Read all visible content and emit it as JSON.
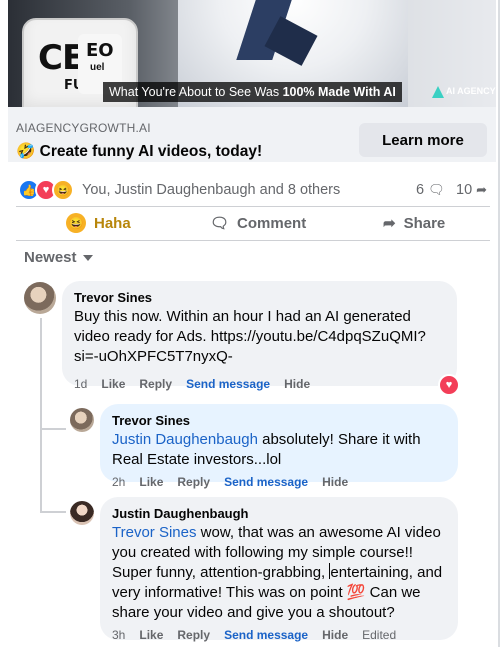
{
  "ad": {
    "caption_prefix": "What You're About to See Was ",
    "caption_bold": "100% Made With AI",
    "can_label_1": "CEO",
    "can_label_2": "FUEL",
    "can2_label_1": "EO",
    "can2_label_2": "uel",
    "brand_label": "AI AGENCY",
    "domain": "AIAGENCYGROWTH.AI",
    "headline_emoji": "🤣",
    "headline": "Create funny AI videos, today!",
    "cta": "Learn more"
  },
  "reactions": {
    "summary": "You, Justin Daughenbaugh and 8 others",
    "comment_count": "6",
    "share_count": "10",
    "icons": [
      "like-icon",
      "love-icon",
      "haha-icon"
    ]
  },
  "actions": {
    "haha": "Haha",
    "comment": "Comment",
    "share": "Share"
  },
  "sort": {
    "label": "Newest"
  },
  "comments": [
    {
      "author": "Trevor Sines",
      "text": "Buy this now. Within an hour I had an AI generated video ready for Ads. https://youtu.be/C4dpqSZuQMI?si=-uOhXPFC5T7nyxQ-",
      "time": "1d",
      "like": "Like",
      "reply": "Reply",
      "send": "Send message",
      "hide": "Hide",
      "reaction": "love"
    },
    {
      "author": "Trevor Sines",
      "mention": "Justin Daughenbaugh",
      "text": " absolutely! Share it with Real Estate investors...lol",
      "time": "2h",
      "like": "Like",
      "reply": "Reply",
      "send": "Send message",
      "hide": "Hide"
    },
    {
      "author": "Justin Daughenbaugh",
      "mention": "Trevor Sines",
      "text_a": " wow, that was an awesome AI video you created with following my simple course!! Super funny, attention-grabbing, ",
      "text_b": "entertaining, and very informative! This was on point 💯 Can we share your video and give you a shoutout?",
      "time": "3h",
      "like": "Like",
      "reply": "Reply",
      "send": "Send message",
      "hide": "Hide",
      "edited": "Edited"
    }
  ]
}
